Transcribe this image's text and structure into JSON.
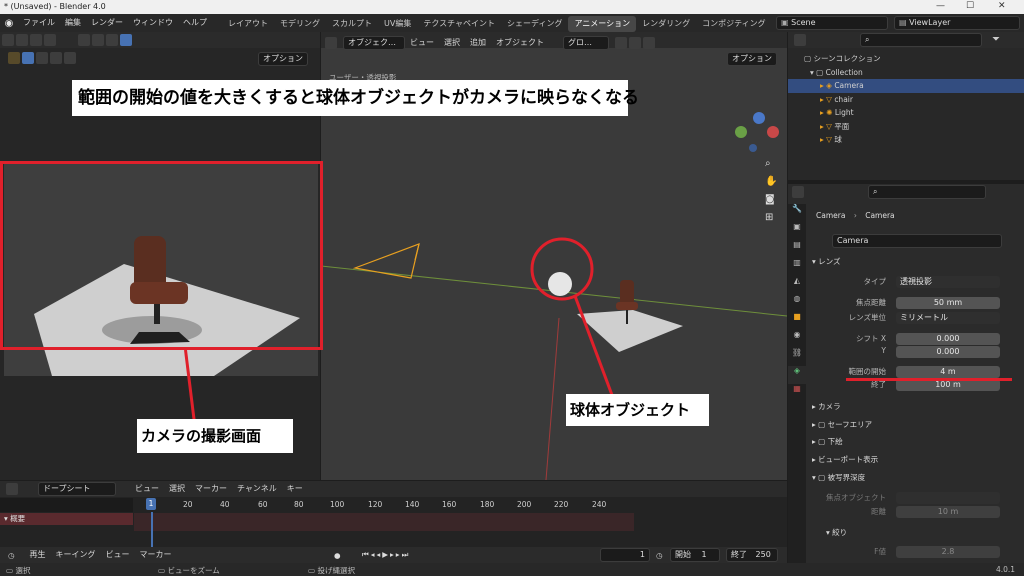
{
  "window": {
    "title": "* (Unsaved) - Blender 4.0",
    "min": "—",
    "max": "☐",
    "close": "✕"
  },
  "menu": [
    "ファイル",
    "編集",
    "レンダー",
    "ウィンドウ",
    "ヘルプ"
  ],
  "workspaces": [
    "レイアウト",
    "モデリング",
    "スカルプト",
    "UV編集",
    "テクスチャペイント",
    "シェーディング",
    "アニメーション",
    "レンダリング",
    "コンポジティング"
  ],
  "active_workspace": "アニメーション",
  "scene": "Scene",
  "view_layer": "ViewLayer",
  "left_viewport": {
    "options": "オプション"
  },
  "main_viewport": {
    "mode": "オブジェク…",
    "menus": [
      "ビュー",
      "選択",
      "追加",
      "オブジェクト"
    ],
    "orientation": "グロ…",
    "options": "オプション",
    "view_name": "ユーザー・透視投影"
  },
  "outliner": {
    "search_placeholder": "",
    "scene_collection": "シーンコレクション",
    "collection": "Collection",
    "items": [
      "Camera",
      "chair",
      "Light",
      "平面",
      "球"
    ]
  },
  "properties": {
    "breadcrumb_object": "Camera",
    "breadcrumb_data": "Camera",
    "datablock": "Camera",
    "lens_panel": "レンズ",
    "type_label": "タイプ",
    "type_value": "透視投影",
    "focal_label": "焦点距離",
    "focal_value": "50 mm",
    "lens_unit_label": "レンズ単位",
    "lens_unit_value": "ミリメートル",
    "shift_x_label": "シフト X",
    "shift_x_value": "0.000",
    "shift_y_label": "Y",
    "shift_y_value": "0.000",
    "clip_start_label": "範囲の開始",
    "clip_start_value": "4 m",
    "clip_end_label": "終了",
    "clip_end_value": "100 m",
    "panels": [
      "カメラ",
      "セーフエリア",
      "下絵",
      "ビューポート表示",
      "被写界深度"
    ],
    "focus_object_label": "焦点オブジェクト",
    "distance_label": "距離",
    "distance_value": "10 m",
    "aperture_panel": "絞り",
    "fstop_label": "F値",
    "fstop_value": "2.8"
  },
  "timeline": {
    "mode": "ドープシート",
    "menus": [
      "ビュー",
      "選択",
      "マーカー",
      "チャンネル",
      "キー"
    ],
    "frame_ticks": [
      "1",
      "20",
      "40",
      "60",
      "80",
      "100",
      "120",
      "140",
      "160",
      "180",
      "200",
      "220",
      "240"
    ],
    "summary": "概要",
    "playback": "再生",
    "keying": "キーイング",
    "view": "ビュー",
    "marker": "マーカー",
    "current_frame": "1",
    "start_label": "開始",
    "start_value": "1",
    "end_label": "終了",
    "end_value": "250"
  },
  "status": {
    "select": "選択",
    "zoom": "ビューをズーム",
    "lasso": "投げ縄選択",
    "version": "4.0.1"
  },
  "annotations": {
    "top": "範囲の開始の値を大きくすると球体オブジェクトがカメラに映らなくなる",
    "camera_view": "カメラの撮影画面",
    "sphere": "球体オブジェクト"
  },
  "colors": {
    "accent_red": "#e0202b",
    "selection_blue": "#334d80",
    "active_blue": "#4772b3"
  }
}
